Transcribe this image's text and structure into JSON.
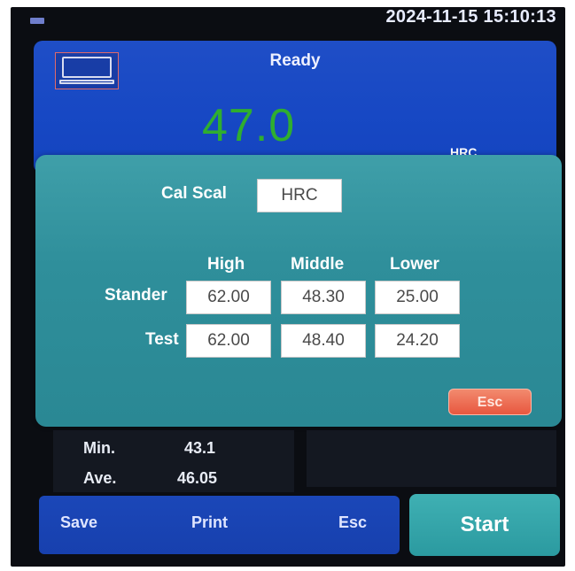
{
  "status_bar": {
    "clock": "2024-11-15 15:10:13",
    "menu_icon": "menu-icon"
  },
  "top_panel": {
    "status": "Ready",
    "reading": "47.0",
    "reading_unit": "HRC",
    "device_icon": "monitor-icon"
  },
  "dialog": {
    "cal_scale_label": "Cal Scal",
    "cal_scale_value": "HRC",
    "columns": [
      "High",
      "Middle",
      "Lower"
    ],
    "rows": [
      {
        "label": "Stander",
        "values": [
          "62.00",
          "48.30",
          "25.00"
        ]
      },
      {
        "label": "Test",
        "values": [
          "62.00",
          "48.40",
          "24.20"
        ]
      }
    ],
    "esc_label": "Esc"
  },
  "stats": {
    "min_label": "Min.",
    "min_value": "43.1",
    "ave_label": "Ave.",
    "ave_value": "46.05"
  },
  "bottom_bar": {
    "save_label": "Save",
    "print_label": "Print",
    "esc_label": "Esc",
    "start_label": "Start"
  },
  "colors": {
    "panel_blue": "#1f4ec6",
    "dialog_teal": "#2f8f9b",
    "reading_green": "#2fae2f",
    "esc_red": "#e8573f",
    "start_teal": "#2b9aa0"
  }
}
